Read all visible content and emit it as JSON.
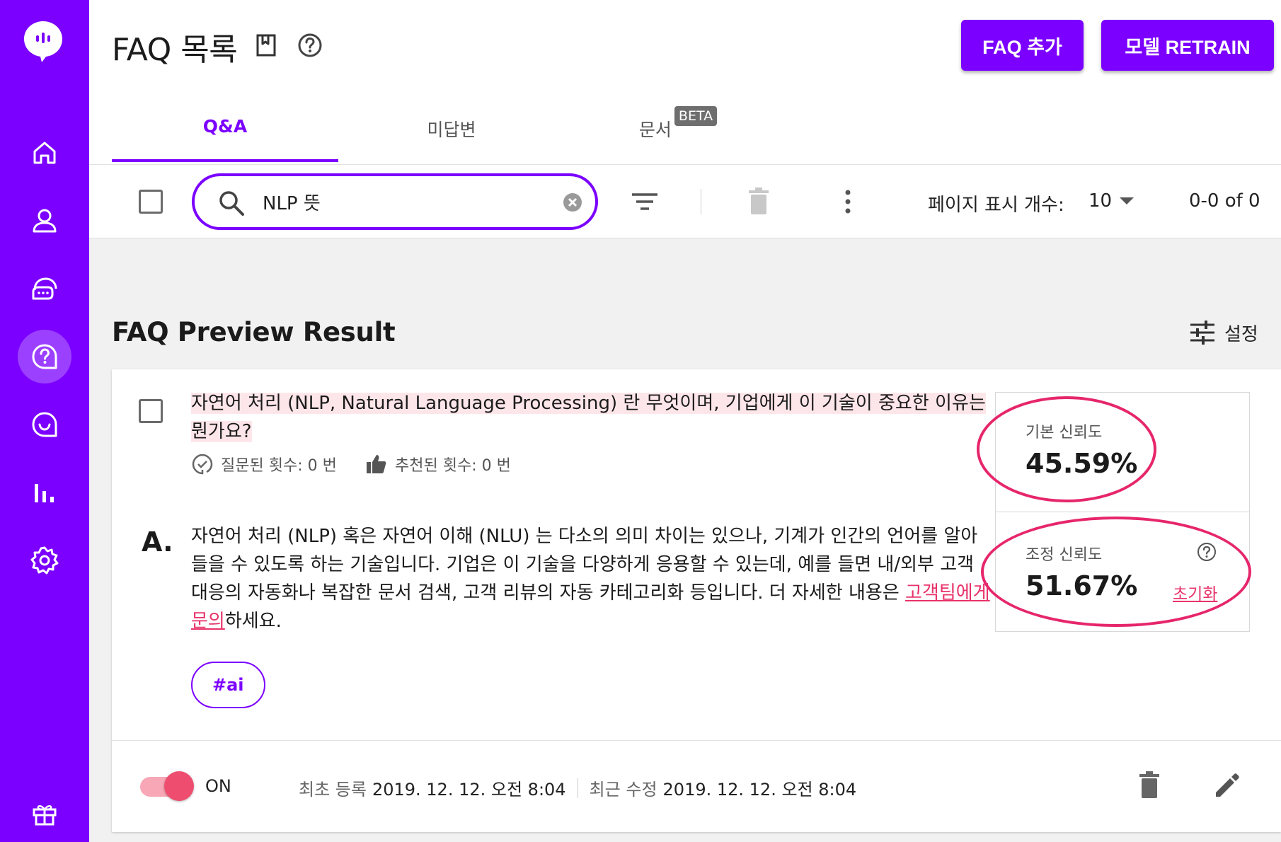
{
  "header": {
    "title": "FAQ 목록",
    "add_button": "FAQ 추가",
    "retrain_button": "모델 RETRAIN"
  },
  "tabs": [
    {
      "label": "Q&A",
      "active": true
    },
    {
      "label": "미답변",
      "active": false
    },
    {
      "label": "문서",
      "badge": "BETA",
      "active": false
    }
  ],
  "toolbar": {
    "search_value": "NLP 뜻",
    "page_size_label": "페이지 표시 개수:",
    "page_size_value": "10",
    "pagination": "0-0 of 0"
  },
  "preview": {
    "title": "FAQ Preview Result",
    "settings_label": "설정"
  },
  "faq": {
    "question": "자연어 처리 (NLP, Natural Language Processing) 란 무엇이며, 기업에게 이 기술이 중요한 이유는 뭔가요?",
    "asked_count": "질문된 횟수: 0 번",
    "recommended_count": "추천된 횟수: 0 번",
    "answer_mark": "A.",
    "answer_text": "자연어 처리 (NLP) 혹은 자연어 이해 (NLU) 는 다소의 의미 차이는 있으나, 기계가 인간의 언어를 알아들을 수 있도록 하는 기술입니다. 기업은 이 기술을 다양하게 응용할 수 있는데, 예를 들면 내/외부 고객 대응의 자동화나 복잡한 문서 검색, 고객 리뷰의 자동 카테고리화 등입니다. 더 자세한 내용은 ",
    "answer_link": "고객팀에게 문의",
    "answer_suffix": "하세요.",
    "tag": "#ai",
    "base_confidence_label": "기본 신뢰도",
    "base_confidence": "45.59%",
    "adjusted_confidence_label": "조정 신뢰도",
    "adjusted_confidence": "51.67%",
    "reset_label": "초기화",
    "toggle_label": "ON",
    "toggle_on": true,
    "created_label": "최초 등록",
    "created_date": "2019. 12. 12. 오전 8:04",
    "updated_label": "최근 수정",
    "updated_date": "2019. 12. 12. 오전 8:04"
  },
  "colors": {
    "brand": "#7b00ff",
    "accent_pink": "#e8336a",
    "annotation": "#e6266b"
  },
  "icons": [
    "logo-icon",
    "home-icon",
    "user-icon",
    "chat-icon",
    "faq-icon",
    "message-icon",
    "stats-icon",
    "settings-icon",
    "gift-icon",
    "bookmark-icon",
    "help-icon",
    "search-icon",
    "clear-icon",
    "filter-icon",
    "delete-icon",
    "more-icon",
    "tune-icon",
    "check-circle-icon",
    "thumb-up-icon",
    "edit-icon"
  ]
}
